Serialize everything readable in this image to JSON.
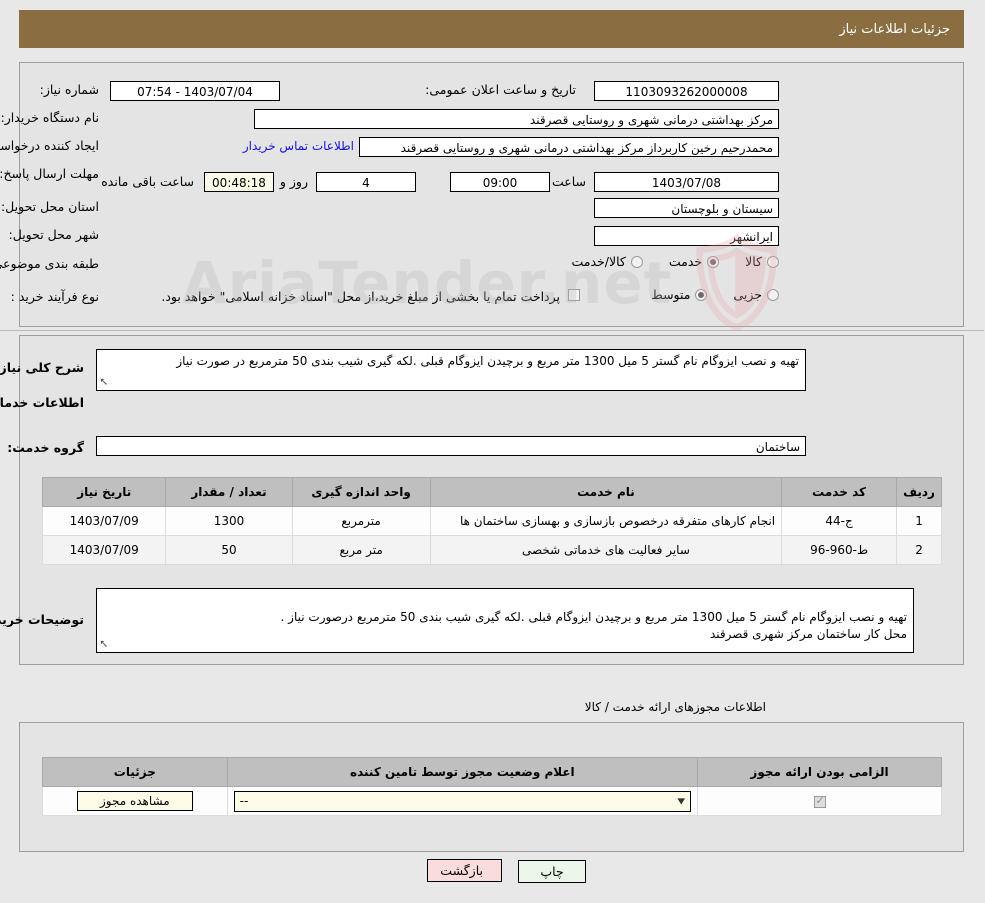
{
  "header": {
    "title": "جزئیات اطلاعات نیاز",
    "bar_color": "#8a6e42"
  },
  "watermark": {
    "text": "AriaTender.net"
  },
  "top_form": {
    "need_number_label": "شماره نیاز:",
    "need_number_value": "1103093262000008",
    "announce_label": "تاریخ و ساعت اعلان عمومی:",
    "announce_value": "1403/07/04 - 07:54",
    "buyer_org_label": "نام دستگاه خریدار:",
    "buyer_org_value": "مرکز بهداشتی درمانی شهری و روستایی قصرقند",
    "requester_label": "ایجاد کننده درخواست:",
    "requester_value": "محمدرحیم رخین کاربرداز مرکز بهداشتی درمانی شهری و روستایی قصرقند",
    "contact_link": "اطلاعات تماس خریدار",
    "deadline_label": "مهلت ارسال پاسخ: تا تاریخ:",
    "deadline_date": "1403/07/08",
    "deadline_hour_label": "ساعت",
    "deadline_hour": "09:00",
    "days_value": "4",
    "days_label": "روز و",
    "remaining_time": "00:48:18",
    "remaining_label": "ساعت باقی مانده",
    "province_label": "استان محل تحویل:",
    "province_value": "سیستان و بلوچستان",
    "city_label": "شهر محل تحویل:",
    "city_value": "ایرانشهر",
    "category_label": "طبقه بندی موضوعی:",
    "category_options": [
      {
        "label": "کالا",
        "selected": false
      },
      {
        "label": "خدمت",
        "selected": true
      },
      {
        "label": "کالا/خدمت",
        "selected": false
      }
    ],
    "process_label": "نوع فرآیند خرید :",
    "process_options": [
      {
        "label": "جزیی",
        "selected": false
      },
      {
        "label": "متوسط",
        "selected": true
      }
    ],
    "treasury_checked": false,
    "treasury_note": "پرداخت تمام یا بخشی از مبلغ خرید،از محل \"اسناد خزانه اسلامی\" خواهد بود."
  },
  "middle": {
    "general_desc_label": "شرح کلی نیاز:",
    "general_desc_value": "تهیه و نصب ایزوگام نام گستر 5 میل 1300 متر مربع و برچیدن ایزوگام قبلی .لکه گیری شیب بندی 50 مترمربع در صورت نیاز",
    "services_heading": "اطلاعات خدمات مورد نیاز",
    "service_group_label": "گروه خدمت:",
    "service_group_value": "ساختمان",
    "table": {
      "columns": [
        "ردیف",
        "کد خدمت",
        "نام خدمت",
        "واحد اندازه گیری",
        "تعداد / مقدار",
        "تاریخ نیاز"
      ],
      "rows": [
        {
          "index": "1",
          "code": "ج-44",
          "name": "انجام کارهای متفرقه درخصوص بازسازی و بهسازی ساختمان ها",
          "unit": "مترمربع",
          "quantity": "1300",
          "date": "1403/07/09"
        },
        {
          "index": "2",
          "code": "ط-960-96",
          "name": "سایر فعالیت های خدماتی شخصی",
          "unit": "متر مربع",
          "quantity": "50",
          "date": "1403/07/09"
        }
      ]
    },
    "buyer_notes_label": "توضیحات خریدار:",
    "buyer_notes_value": "تهیه و نصب ایزوگام نام گستر 5 میل 1300 متر مربع و برچیدن ایزوگام قبلی .لکه گیری شیب بندی 50 مترمربع درصورت نیاز  .\nمحل کار ساختمان مرکز شهری قصرقند"
  },
  "permits": {
    "section_label": "اطلاعات مجوزهای ارائه خدمت / کالا",
    "columns": [
      "الزامی بودن ارائه مجوز",
      "اعلام وضعیت مجوز توسط تامین کننده",
      "جزئیات"
    ],
    "rows": [
      {
        "required_checked": true,
        "status_value": "--",
        "details_button": "مشاهده مجوز"
      }
    ]
  },
  "footer": {
    "print_label": "چاپ",
    "back_label": "بازگشت"
  }
}
